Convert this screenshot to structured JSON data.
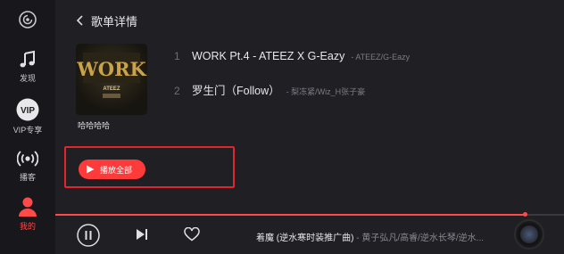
{
  "sidebar": {
    "items": [
      {
        "label": "发现",
        "icon": "music-note-icon"
      },
      {
        "label": "VIP专享",
        "icon": "vip-icon",
        "badge": "VIP"
      },
      {
        "label": "播客",
        "icon": "podcast-icon"
      },
      {
        "label": "我的",
        "icon": "user-icon",
        "active": true
      }
    ]
  },
  "header": {
    "title": "歌单详情"
  },
  "playlist": {
    "name": "哈哈哈哈",
    "cover_text": "WORK",
    "cover_subtext": "ATEEZ",
    "songs": [
      {
        "index": "1",
        "title": "WORK Pt.4 - ATEEZ X G-Eazy",
        "artist": "- ATEEZ/G-Eazy"
      },
      {
        "index": "2",
        "title": "罗生门（Follow）",
        "artist": "- 梨冻紧/Wiz_H张子豪"
      }
    ],
    "play_all_label": "播放全部"
  },
  "player": {
    "now_title": "着魔 (逆水寒时装推广曲)",
    "separator": " - ",
    "now_artist": "黄子弘凡/高睿/逆水长琴/逆水...",
    "progress": 0.922
  },
  "colors": {
    "accent": "#ff3a3a",
    "highlight_box": "#e0262b"
  }
}
